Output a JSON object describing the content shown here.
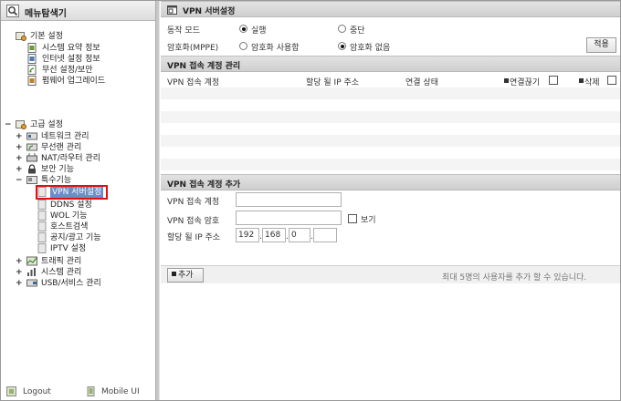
{
  "left_panel": {
    "title": "메뉴탐색기",
    "basic": {
      "label": "기본 설정",
      "items": [
        "시스템 요약 정보",
        "인터넷 설정 정보",
        "무선 설정/보안",
        "펌웨어 업그레이드"
      ]
    },
    "advanced": {
      "label": "고급 설정",
      "items": [
        "네트워크 관리",
        "무선랜 관리",
        "NAT/라우터 관리",
        "보안 기능"
      ],
      "special": {
        "label": "특수기능",
        "items": [
          "VPN 서버설정",
          "DDNS 설정",
          "WOL 기능",
          "호스트검색",
          "공지/광고 기능",
          "IPTV 설정"
        ],
        "selected": "VPN 서버설정"
      },
      "more_items": [
        "트래픽 관리",
        "시스템 관리",
        "USB/서비스 관리"
      ]
    },
    "footer": {
      "logout": "Logout",
      "mobile": "Mobile UI"
    }
  },
  "vpn": {
    "title": "VPN 서버설정",
    "mode_label": "동작 모드",
    "mode_options": [
      "실행",
      "중단"
    ],
    "mode_selected": "실행",
    "mppe_label": "암호화(MPPE)",
    "mppe_options": [
      "암호화 사용함",
      "암호화 없음"
    ],
    "mppe_selected": "암호화 없음",
    "apply_button": "적용"
  },
  "accounts": {
    "title": "VPN 접속 계정 관리",
    "columns": {
      "account": "VPN 접속 계정",
      "ip": "할당 될 IP 주소",
      "status": "연결 상태",
      "disconnect": "연결끊기",
      "delete": "삭제"
    },
    "rows": []
  },
  "add_account": {
    "title": "VPN 접속 계정 추가",
    "account_label": "VPN 접속 계정",
    "account_value": "",
    "password_label": "VPN 접속 암호",
    "password_value": "",
    "show_label": "보기",
    "ip_label": "할당 될 IP 주소",
    "ip_octets": [
      "192",
      "168",
      "0",
      ""
    ],
    "add_button": "추가",
    "note": "최대 5명의 사용자를 추가 할 수 있습니다."
  }
}
